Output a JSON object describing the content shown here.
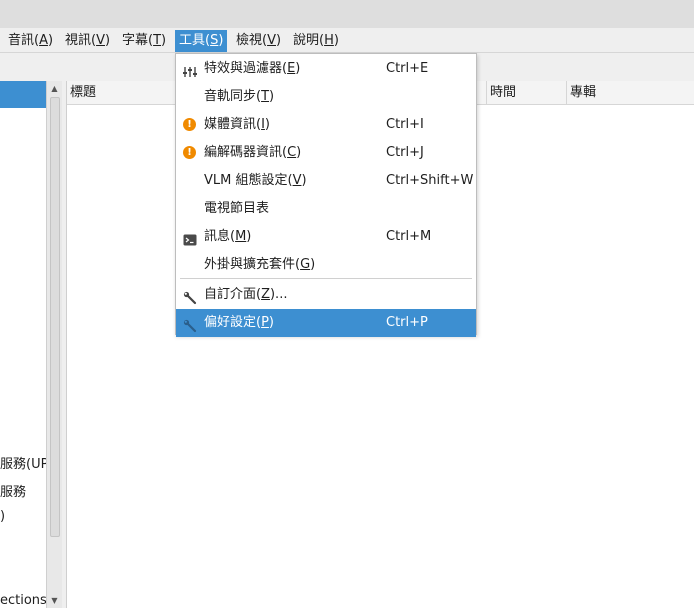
{
  "menubar": {
    "items": [
      {
        "text": "音訊(",
        "key": "A",
        "tail": ")"
      },
      {
        "text": "視訊(",
        "key": "V",
        "tail": ")"
      },
      {
        "text": "字幕(",
        "key": "T",
        "tail": ")"
      },
      {
        "text": "工具(",
        "key": "S",
        "tail": ")"
      },
      {
        "text": "檢視(",
        "key": "V",
        "tail": ")"
      },
      {
        "text": "說明(",
        "key": "H",
        "tail": ")"
      }
    ]
  },
  "sidebar": {
    "items": [
      "服務(UPnP",
      "服務",
      ")",
      "ections"
    ]
  },
  "playlist": {
    "columns": [
      "標題",
      "時間",
      "專輯"
    ]
  },
  "tools_menu": {
    "items": [
      {
        "text": "特效與過濾器(",
        "key": "E",
        "tail": ")",
        "shortcut": "Ctrl+E",
        "icon": "equalizer-icon"
      },
      {
        "text": "音軌同步(",
        "key": "T",
        "tail": ")",
        "shortcut": "",
        "icon": ""
      },
      {
        "text": "媒體資訊(",
        "key": "I",
        "tail": ")",
        "shortcut": "Ctrl+I",
        "icon": "info-warning-icon"
      },
      {
        "text": "編解碼器資訊(",
        "key": "C",
        "tail": ")",
        "shortcut": "Ctrl+J",
        "icon": "info-warning-icon"
      },
      {
        "text": "VLM 組態設定(",
        "key": "V",
        "tail": ")",
        "shortcut": "Ctrl+Shift+W",
        "icon": ""
      },
      {
        "text": "電視節目表",
        "key": "",
        "tail": "",
        "shortcut": "",
        "icon": ""
      },
      {
        "text": "訊息(",
        "key": "M",
        "tail": ")",
        "shortcut": "Ctrl+M",
        "icon": "terminal-icon"
      },
      {
        "text": "外掛與擴充套件(",
        "key": "G",
        "tail": ")",
        "shortcut": "",
        "icon": ""
      },
      {
        "text": "自訂介面(",
        "key": "Z",
        "tail": ")...",
        "shortcut": "",
        "icon": "wrench-icon"
      },
      {
        "text": "偏好設定(",
        "key": "P",
        "tail": ")",
        "shortcut": "Ctrl+P",
        "icon": "wrench-icon"
      }
    ]
  },
  "colors": {
    "accent": "#3d8fd1",
    "warning": "#f08a00",
    "menubar_bg": "#efefef"
  }
}
